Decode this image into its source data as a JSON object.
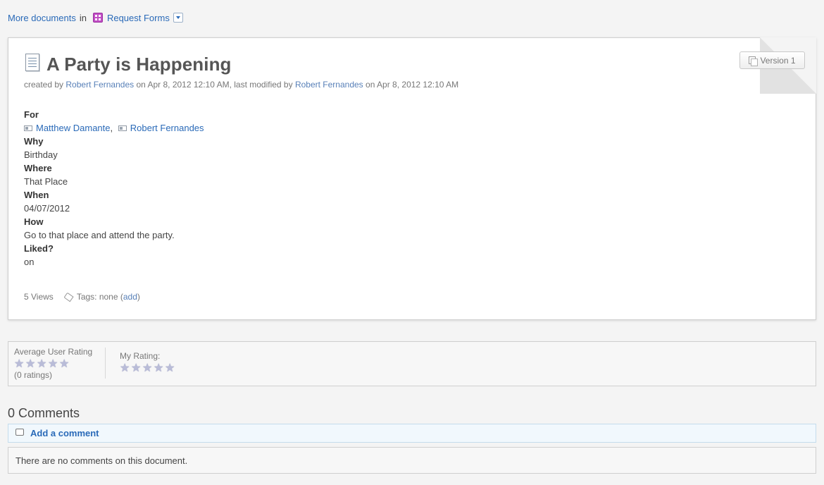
{
  "breadcrumb": {
    "more_documents": "More documents",
    "in_text": "in",
    "place": "Request Forms"
  },
  "document": {
    "title": "A Party is Happening",
    "version_label": "Version 1",
    "meta": {
      "created_prefix": "created by",
      "creator": "Robert Fernandes",
      "created_on": "on Apr 8, 2012 12:10 AM, last modified by",
      "modifier": "Robert Fernandes",
      "modified_on": "on Apr 8, 2012 12:10 AM"
    },
    "fields": {
      "for_label": "For",
      "for_people": [
        "Matthew Damante",
        "Robert Fernandes"
      ],
      "for_separator": ",",
      "why_label": "Why",
      "why_value": "Birthday",
      "where_label": "Where",
      "where_value": "That Place",
      "when_label": "When",
      "when_value": "04/07/2012",
      "how_label": "How",
      "how_value": "Go to that place and attend the party.",
      "liked_label": "Liked?",
      "liked_value": "on"
    },
    "footer": {
      "views": "5 Views",
      "tags_text": "Tags: none (",
      "add_link": "add",
      "tags_close": ")"
    }
  },
  "rating": {
    "average_label": "Average User Rating",
    "average_count": "(0 ratings)",
    "average_stars": 0,
    "my_label": "My Rating:",
    "my_stars": 0,
    "max_stars": 5
  },
  "comments": {
    "title": "0 Comments",
    "add_label": "Add a comment",
    "empty_text": "There are no comments on this document."
  },
  "colors": {
    "link": "#2a6ab8",
    "background": "#f4f4f4",
    "forms_icon": "#c14fc5"
  }
}
